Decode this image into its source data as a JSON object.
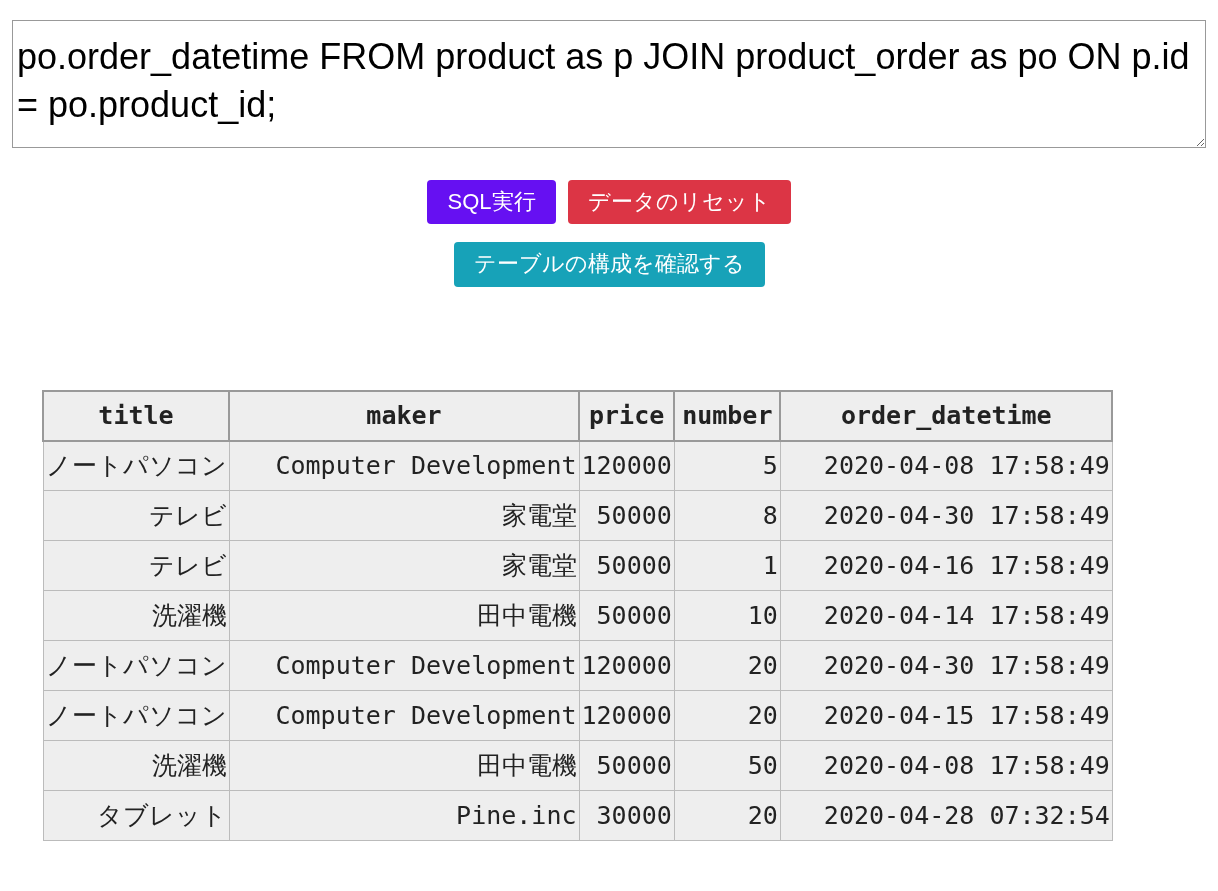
{
  "query_editor": {
    "value": "po.order_datetime FROM product as p JOIN product_order as po ON p.id = po.product_id;"
  },
  "buttons": [
    {
      "label": "SQL実行",
      "kind": "primary"
    },
    {
      "label": "データのリセット",
      "kind": "danger"
    },
    {
      "label": "テーブルの構成を確認する",
      "kind": "info"
    }
  ],
  "table": {
    "columns": [
      "title",
      "maker",
      "price",
      "number",
      "order_datetime"
    ],
    "rows": [
      [
        "ノートパソコン",
        "Computer Development",
        "120000",
        "5",
        "2020-04-08 17:58:49"
      ],
      [
        "テレビ",
        "家電堂",
        "50000",
        "8",
        "2020-04-30 17:58:49"
      ],
      [
        "テレビ",
        "家電堂",
        "50000",
        "1",
        "2020-04-16 17:58:49"
      ],
      [
        "洗濯機",
        "田中電機",
        "50000",
        "10",
        "2020-04-14 17:58:49"
      ],
      [
        "ノートパソコン",
        "Computer Development",
        "120000",
        "20",
        "2020-04-30 17:58:49"
      ],
      [
        "ノートパソコン",
        "Computer Development",
        "120000",
        "20",
        "2020-04-15 17:58:49"
      ],
      [
        "洗濯機",
        "田中電機",
        "50000",
        "50",
        "2020-04-08 17:58:49"
      ],
      [
        "タブレット",
        "Pine.inc",
        "30000",
        "20",
        "2020-04-28 07:32:54"
      ]
    ]
  }
}
